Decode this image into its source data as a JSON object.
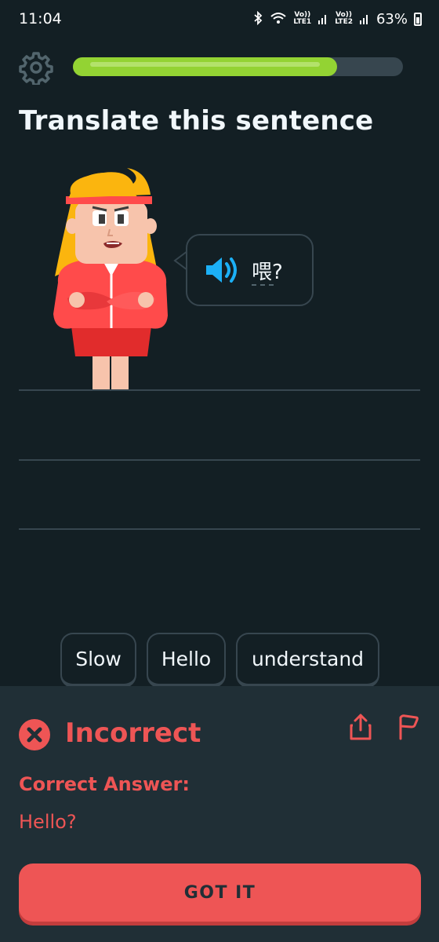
{
  "status_bar": {
    "time": "11:04",
    "sim1_top": "Vo))",
    "sim1_bottom": "LTE1",
    "sim2_top": "Vo))",
    "sim2_bottom": "LTE2",
    "battery": "63%"
  },
  "header": {
    "progress_fraction": 0.8
  },
  "title": "Translate this sentence",
  "bubble": {
    "text": "喂?"
  },
  "word_bank": [
    "Slow",
    "Hello",
    "understand"
  ],
  "feedback": {
    "title": "Incorrect",
    "correct_label": "Correct Answer:",
    "correct_value": "Hello?",
    "button": "GOT IT"
  },
  "colors": {
    "background": "#131f24",
    "progress_fill": "#93d333",
    "feedback_red": "#ee5555",
    "sheet_bg": "#202f36",
    "speaker_blue": "#1cb0f6"
  }
}
